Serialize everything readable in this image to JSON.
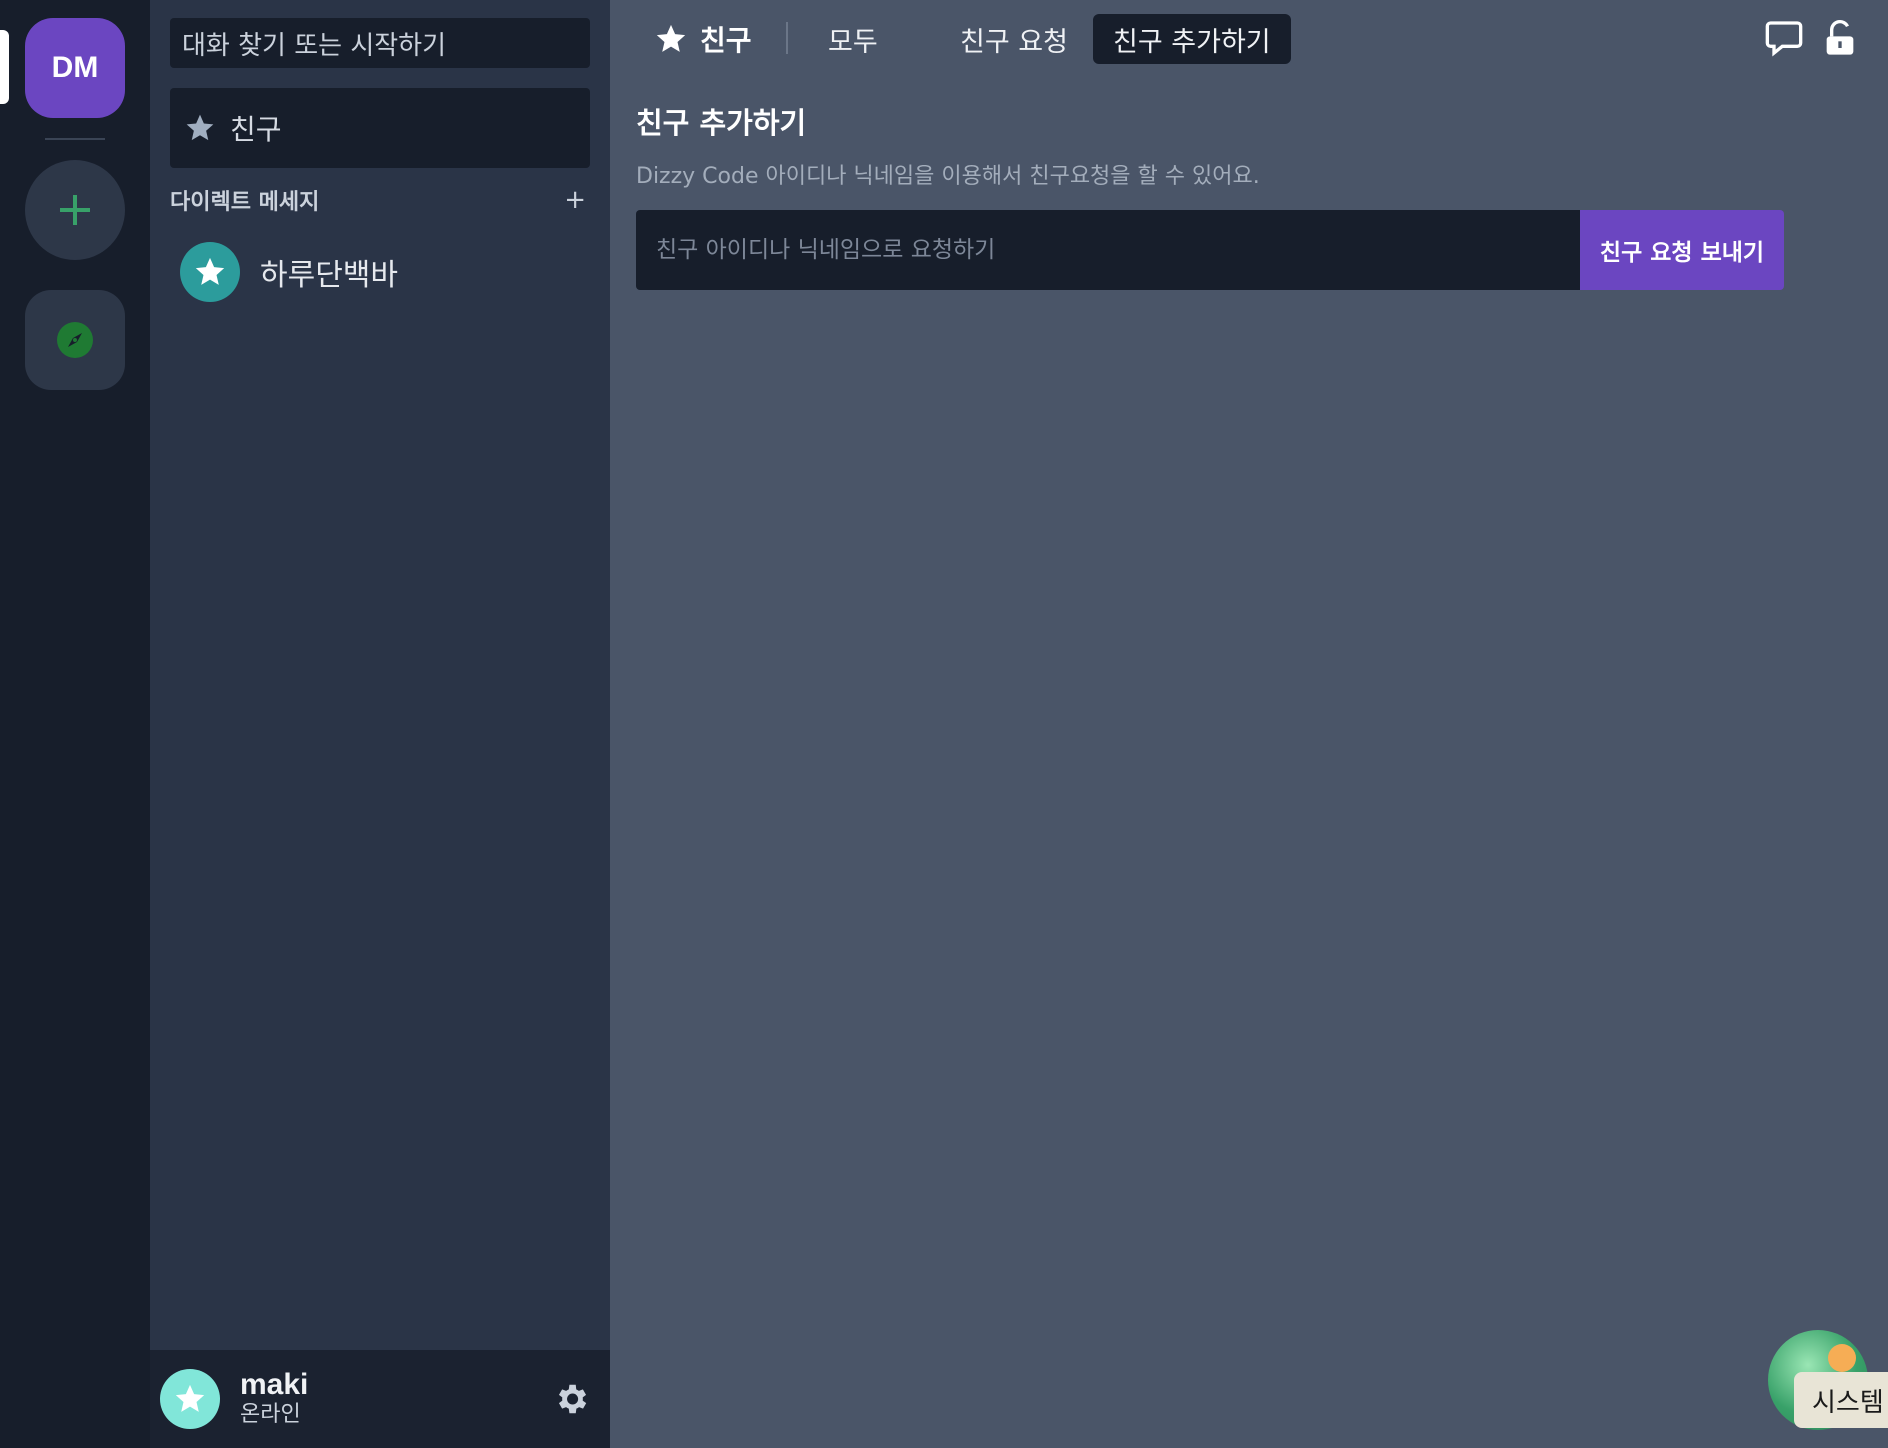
{
  "rail": {
    "dm_label": "DM"
  },
  "sidebar": {
    "search_placeholder": "대화 찾기 또는 시작하기",
    "friends_label": "친구",
    "dm_section_title": "다이렉트 메세지",
    "dm_add": "+",
    "dms": [
      {
        "name": "하루단백바"
      }
    ],
    "user": {
      "name": "maki",
      "status": "온라인"
    }
  },
  "topbar": {
    "home_label": "친구",
    "tabs": [
      {
        "label": "모두",
        "active": false
      },
      {
        "label": "친구 요청",
        "active": false
      },
      {
        "label": "친구 추가하기",
        "active": true
      }
    ]
  },
  "add_friend": {
    "title": "친구 추가하기",
    "description": "Dizzy Code 아이디나 닉네임을 이용해서 친구요청을 할 수 있어요.",
    "input_placeholder": "친구 아이디나 닉네임으로 요청하기",
    "input_value": "",
    "button_label": "친구 요청 보내기"
  },
  "system_widget": {
    "label": "시스템"
  },
  "colors": {
    "accent": "#6b46c1",
    "rail_bg": "#171e2b",
    "sidebar_bg": "#2a3447",
    "main_bg": "#4a5568",
    "add_icon": "#38a169",
    "dm_avatar": "#2c9c9c",
    "user_avatar": "#81e6d9"
  },
  "icons": {
    "home": "star-icon",
    "add_server": "plus-icon",
    "explore": "compass-icon",
    "new_dm": "chat-bubble-icon",
    "lock": "lock-icon",
    "settings": "gear-icon"
  }
}
